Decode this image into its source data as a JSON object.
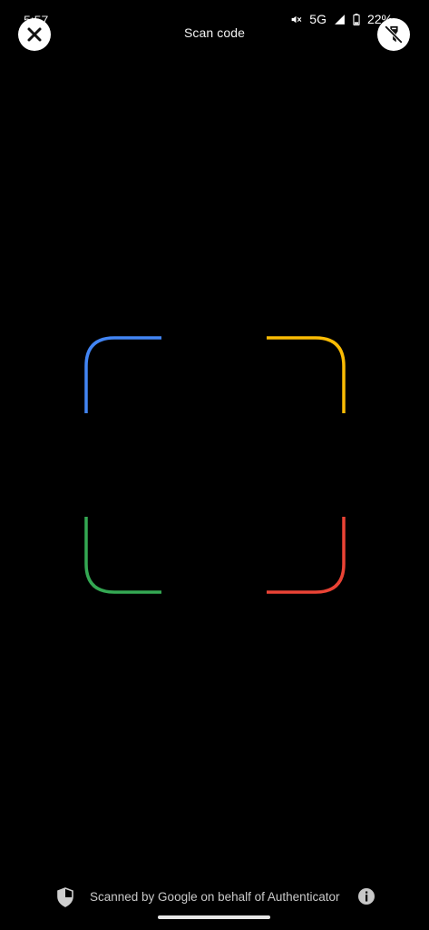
{
  "status_bar": {
    "time": "5:57",
    "network": "5G",
    "battery": "22%"
  },
  "header": {
    "title": "Scan code",
    "close_icon": "close-icon",
    "flash_icon": "flash-off-icon"
  },
  "viewfinder": {
    "corners": {
      "top_left": "#4285F4",
      "top_right": "#FBBC04",
      "bottom_left": "#34A853",
      "bottom_right": "#EA4335"
    }
  },
  "footer": {
    "text": "Scanned by Google on behalf of Authenticator",
    "shield_icon": "shield-icon",
    "info_icon": "info-icon"
  }
}
